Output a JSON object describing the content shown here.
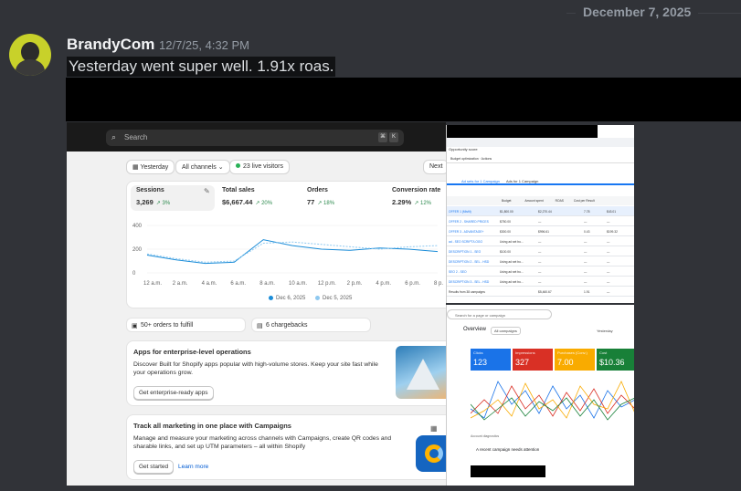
{
  "date_divider": "December 7, 2025",
  "message": {
    "username": "BrandyCom",
    "timestamp": "12/7/25, 4:32 PM",
    "text": "Yesterday went super well. 1.91x roas."
  },
  "shopify": {
    "search_placeholder": "Search",
    "kbd1": "⌘",
    "kbd2": "K",
    "date_range": "Yesterday",
    "channels": "All channels",
    "live_visitors": "23 live visitors",
    "next_label": "Next",
    "metrics": [
      {
        "title": "Sessions",
        "value": "3,269",
        "change": "↗ 3%"
      },
      {
        "title": "Total sales",
        "value": "$6,667.44",
        "change": "↗ 20%"
      },
      {
        "title": "Orders",
        "value": "77",
        "change": "↗ 18%"
      },
      {
        "title": "Conversion rate",
        "value": "2.29%",
        "change": "↗ 12%"
      }
    ],
    "y_ticks": [
      "400",
      "200",
      "0"
    ],
    "x_ticks": [
      "12 a.m.",
      "2 a.m.",
      "4 a.m.",
      "6 a.m.",
      "8 a.m.",
      "10 a.m.",
      "12 p.m.",
      "2 p.m.",
      "4 p.m.",
      "6 p.m.",
      "8 p."
    ],
    "legend": [
      "Dec 6, 2025",
      "Dec 5, 2025"
    ],
    "orders_to_fulfill": "50+ orders to fulfill",
    "chargebacks": "6 chargebacks",
    "enterprise_title": "Apps for enterprise-level operations",
    "enterprise_text": "Discover Built for Shopify apps popular with high-volume stores. Keep your site fast while your operations grow.",
    "enterprise_button": "Get enterprise-ready apps",
    "campaigns_title": "Track all marketing in one place with Campaigns",
    "campaigns_text": "Manage and measure your marketing across channels with Campaigns, create QR codes and sharable links, and set up UTM parameters – all within Shopify",
    "get_started": "Get started",
    "learn_more": "Learn more"
  },
  "chart_data": {
    "type": "line",
    "title": "Sessions",
    "x": [
      "12 a.m.",
      "2 a.m.",
      "4 a.m.",
      "6 a.m.",
      "8 a.m.",
      "10 a.m.",
      "12 p.m.",
      "2 p.m.",
      "4 p.m.",
      "6 p.m.",
      "8 p."
    ],
    "ylim": [
      0,
      400
    ],
    "series": [
      {
        "name": "Dec 6, 2025",
        "values": [
          150,
          110,
          80,
          90,
          280,
          230,
          200,
          190,
          210,
          200,
          180
        ]
      },
      {
        "name": "Dec 5, 2025",
        "values": [
          160,
          120,
          90,
          100,
          250,
          260,
          240,
          220,
          200,
          220,
          230
        ]
      }
    ]
  },
  "meta_ads": {
    "header_title": "Opportunity score",
    "ads_tab": "Ads for 1 Campaign",
    "adsets_tab": "Ad sets for 1 Campaign",
    "columns": [
      "Budget",
      "Amount spent",
      "ROAS",
      "Cost per Result",
      "Results"
    ],
    "rows": [
      {
        "name": "OFFER 1 (Misfit)",
        "budget": "$1,800.00",
        "spent": "$2,270.44",
        "roas": "7.78",
        "cpr": "$43.01"
      },
      {
        "name": "OFFER 2 - SHARED PRICES",
        "budget": "$750.00",
        "spent": "—",
        "roas": "—",
        "cpr": "—"
      },
      {
        "name": "OFFER 3 - ADVANTAGE+",
        "budget": "$300.00",
        "spent": "$996.61",
        "roas": "0.43",
        "cpr": "$199.32"
      },
      {
        "name": "ad - SEO SCRIPT/LOGO",
        "budget": "Using ad set bu...",
        "spent": "—",
        "roas": "—",
        "cpr": "—"
      },
      {
        "name": "DESCRIPTION 1 - SEO",
        "budget": "$100.00",
        "spent": "—",
        "roas": "—",
        "cpr": "—"
      },
      {
        "name": "DESCRIPTION 2 - SEL - HSD",
        "budget": "Using ad set bu...",
        "spent": "—",
        "roas": "—",
        "cpr": "—"
      },
      {
        "name": "SEO 2 - SEO",
        "budget": "Using ad set bu...",
        "spent": "—",
        "roas": "—",
        "cpr": "—"
      },
      {
        "name": "DESCRIPTION 3 - SEL - HSD",
        "budget": "Using ad set bu...",
        "spent": "—",
        "roas": "—",
        "cpr": "—"
      },
      {
        "name": "Results from 38 campaigns",
        "budget": "",
        "spent": "$5,460.67",
        "roas": "1.91",
        "cpr": "—"
      }
    ]
  },
  "google_ads": {
    "search_placeholder": "Search for a page or campaign",
    "overview": "Overview",
    "view": "All campaigns",
    "date": "Yesterday",
    "tiles": [
      {
        "label": "Clicks",
        "value": "123",
        "color": "#1a73e8"
      },
      {
        "label": "Impressions",
        "value": "327",
        "color": "#d93025"
      },
      {
        "label": "Purchases (Conv.)",
        "value": "7.00",
        "color": "#f9ab00"
      },
      {
        "label": "Cost",
        "value": "$10.36",
        "color": "#188038"
      }
    ],
    "alert_title": "Account diagnostics",
    "alert_text": "A recent campaign needs attention"
  }
}
